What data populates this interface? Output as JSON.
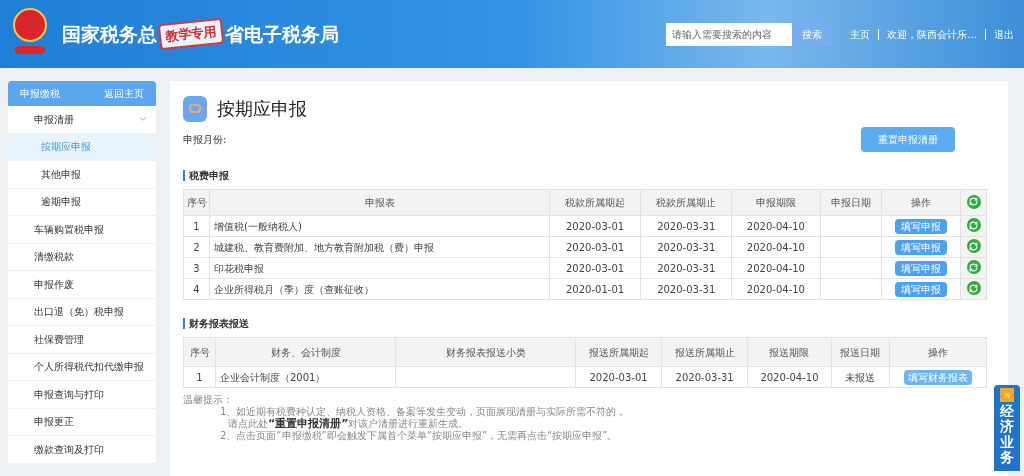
{
  "header": {
    "title_left": "国家税务总",
    "stamp": "教学专用",
    "title_right": "省电子税务局",
    "search": {
      "placeholder": "请输入需要搜索的内容",
      "button": "搜索"
    },
    "links": [
      "主页",
      "欢迎，陕西会计乐...",
      "退出"
    ]
  },
  "sidebar": {
    "title": "申报缴税",
    "back": "返回主页",
    "items": [
      {
        "label": "申报清册",
        "expanded": true,
        "selected": false,
        "children": [
          {
            "label": "按期应申报",
            "selected": true
          },
          {
            "label": "其他申报",
            "selected": false
          },
          {
            "label": "逾期申报",
            "selected": false
          }
        ]
      },
      {
        "label": "车辆购置税申报",
        "selected": false
      },
      {
        "label": "清缴税款",
        "selected": false
      },
      {
        "label": "申报作废",
        "selected": false
      },
      {
        "label": "出口退（免）税申报",
        "selected": false
      },
      {
        "label": "社保费管理",
        "selected": false
      },
      {
        "label": "个人所得税代扣代缴申报",
        "selected": false
      },
      {
        "label": "申报查询与打印",
        "selected": false
      },
      {
        "label": "申报更正",
        "selected": false
      },
      {
        "label": "缴款查询及打印",
        "selected": false
      }
    ]
  },
  "page": {
    "title": "按期应申报",
    "month_label": "申报月份:",
    "reset_button": "重置申报清册"
  },
  "tax_section": {
    "title": "税费申报",
    "columns": [
      "序号",
      "申报表",
      "税款所属期起",
      "税款所属期止",
      "申报期限",
      "申报日期",
      "操作"
    ],
    "rows": [
      {
        "no": "1",
        "form": "增值税(一般纳税人)",
        "start": "2020-03-01",
        "end": "2020-03-31",
        "deadline": "2020-04-10",
        "action": "填写申报"
      },
      {
        "no": "2",
        "form": "城建税、教育费附加、地方教育附加税（费）申报",
        "start": "2020-03-01",
        "end": "2020-03-31",
        "deadline": "2020-04-10",
        "action": "填写申报"
      },
      {
        "no": "3",
        "form": "印花税申报",
        "start": "2020-03-01",
        "end": "2020-03-31",
        "deadline": "2020-04-10",
        "action": "填写申报"
      },
      {
        "no": "4",
        "form": "企业所得税月（季）度（查账征收）",
        "start": "2020-01-01",
        "end": "2020-03-31",
        "deadline": "2020-04-10",
        "action": "填写申报"
      }
    ]
  },
  "report_section": {
    "title": "财务报表报送",
    "columns": [
      "序号",
      "财务、会计制度",
      "财务报表报送小类",
      "报送所属期起",
      "报送所属期止",
      "报送期限",
      "报送日期",
      "操作"
    ],
    "rows": [
      {
        "no": "1",
        "system": "企业会计制度（2001）",
        "start": "2020-03-01",
        "end": "2020-03-31",
        "deadline": "2020-04-10",
        "date": "未报送",
        "action": "填写财务报表"
      }
    ]
  },
  "tips": {
    "title": "温馨提示：",
    "lines": [
      "1、如近期有税费种认定、纳税人资格、备案等发生变动，页面展现清册与实际所需不符的，",
      "请点此处**“重置申报清册”**对该户清册进行重新生成。",
      "2、点击页面“申报缴税”即会触发下属首个菜单“按期应申报”，无需再点击“按期应申报”。"
    ]
  },
  "side_tab": {
    "label": "经济业务"
  }
}
